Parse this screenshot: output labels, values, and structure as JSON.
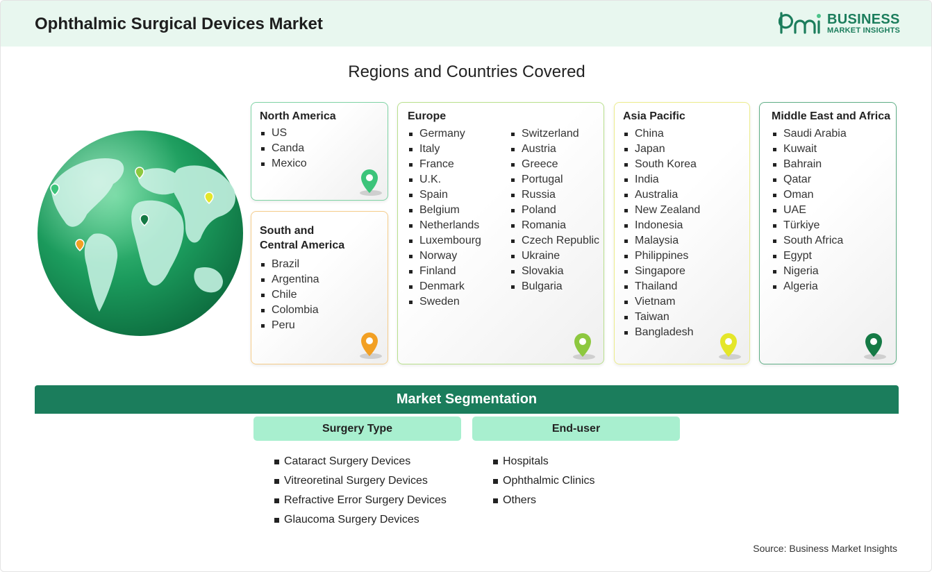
{
  "header": {
    "title": "Ophthalmic Surgical Devices Market",
    "logo_line1": "BUSINESS",
    "logo_line2": "MARKET INSIGHTS",
    "logo_mark": "bmi"
  },
  "regions_title": "Regions and Countries Covered",
  "regions": [
    {
      "name": "North America",
      "pin_color": "#3cc47a",
      "border_color": "#7fd3a4",
      "columns": [
        [
          "US",
          "Canda",
          "Mexico"
        ]
      ]
    },
    {
      "name": "South and\nCentral America",
      "name_line1": "South and",
      "name_line2": "Central America",
      "pin_color": "#f2a024",
      "border_color": "#f5cc8a",
      "columns": [
        [
          "Brazil",
          "Argentina",
          "Chile",
          "Colombia",
          "Peru"
        ]
      ]
    },
    {
      "name": "Europe",
      "pin_color": "#8dc83f",
      "border_color": "#b8e08c",
      "columns": [
        [
          "Germany",
          "Italy",
          "France",
          "U.K.",
          "Spain",
          "Belgium",
          "Netherlands",
          "Luxembourg",
          "Norway",
          "Finland",
          "Denmark",
          "Sweden"
        ],
        [
          "Switzerland",
          "Austria",
          "Greece",
          "Portugal",
          "Russia",
          "Poland",
          "Romania",
          "Czech Republic",
          "Ukraine",
          "Slovakia",
          "Bulgaria"
        ]
      ]
    },
    {
      "name": "Asia Pacific",
      "pin_color": "#e4e62a",
      "border_color": "#ecec8c",
      "columns": [
        [
          "China",
          "Japan",
          "South Korea",
          "India",
          "Australia",
          "New Zealand",
          "Indonesia",
          "Malaysia",
          "Philippines",
          "Singapore",
          "Thailand",
          "Vietnam",
          "Taiwan",
          "Bangladesh"
        ]
      ]
    },
    {
      "name": "Middle East and Africa",
      "pin_color": "#157a45",
      "border_color": "#5fae86",
      "columns": [
        [
          "Saudi Arabia",
          "Kuwait",
          "Bahrain",
          "Qatar",
          "Oman",
          "UAE",
          "Türkiye",
          "South Africa",
          "Egypt",
          "Nigeria",
          "Algeria"
        ]
      ]
    }
  ],
  "segmentation": {
    "title": "Market Segmentation",
    "groups": [
      {
        "name": "Surgery Type",
        "items": [
          "Cataract Surgery Devices",
          "Vitreoretinal Surgery Devices",
          "Refractive Error Surgery Devices",
          "Glaucoma Surgery Devices"
        ]
      },
      {
        "name": "End-user",
        "items": [
          "Hospitals",
          "Ophthalmic Clinics",
          "Others"
        ]
      }
    ]
  },
  "source": "Source: Business Market Insights",
  "colors": {
    "brand": "#1b7d5c",
    "header_bg": "#e8f7ef",
    "segment_head_bg": "#a8efcf"
  },
  "icons": [
    "globe-icon",
    "map-pin-icon",
    "bmi-logo-icon"
  ]
}
